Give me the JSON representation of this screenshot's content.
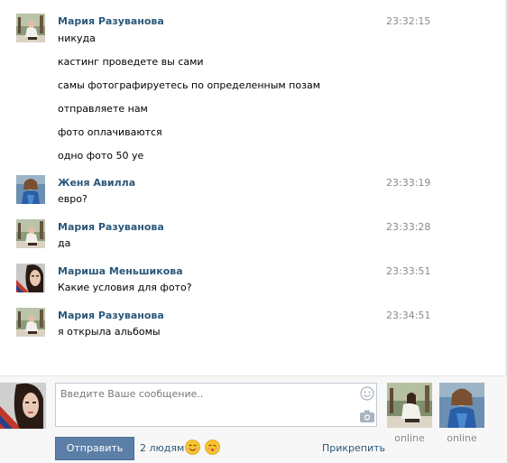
{
  "messages": [
    {
      "author": "Мария Разуванова",
      "time": "23:32:15",
      "avatar": "maria-avatar",
      "lines": [
        "никуда",
        "кастинг проведете вы сами",
        "самы фотографируетесь по определенным позам",
        "отправляете нам",
        "фото оплачиваются",
        "одно фото 50 уе"
      ]
    },
    {
      "author": "Женя Авилла",
      "time": "23:33:19",
      "avatar": "zhenya-avatar",
      "lines": [
        "евро?"
      ]
    },
    {
      "author": "Мария Разуванова",
      "time": "23:33:28",
      "avatar": "maria-avatar",
      "lines": [
        "да"
      ]
    },
    {
      "author": "Мариша Меньшикова",
      "time": "23:33:51",
      "avatar": "marisha-avatar",
      "lines": [
        "Какие условия для фото?"
      ]
    },
    {
      "author": "Мария Разуванова",
      "time": "23:34:51",
      "avatar": "maria-avatar",
      "lines": [
        "я открыла альбомы"
      ]
    }
  ],
  "composer": {
    "placeholder": "Введите Ваше сообщение..",
    "send_label": "Отправить",
    "recipients_count": "2 людям",
    "attach_label": "Прикрепить",
    "icons": [
      "smiley-icon",
      "camera-icon"
    ],
    "emoji": [
      "smiling-face-emoji",
      "kissing-face-emoji"
    ]
  },
  "participants": [
    {
      "status": "online"
    },
    {
      "status": "online"
    }
  ],
  "colors": {
    "author": "#2b587a",
    "time": "#8a8a8a",
    "button": "#5b7fa6",
    "composer_bg": "#f7f7f7"
  }
}
